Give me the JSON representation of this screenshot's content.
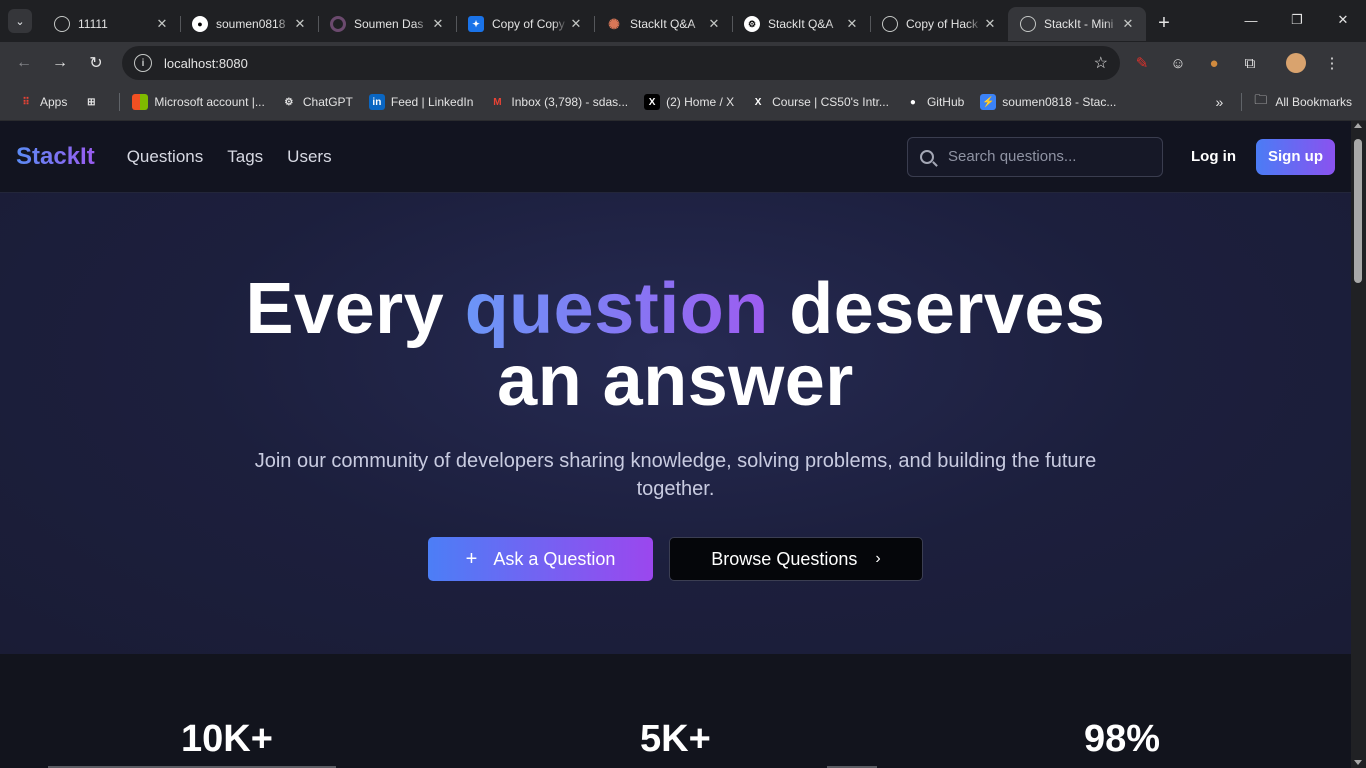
{
  "browser": {
    "tabs": [
      {
        "title": "11111",
        "favicon": "globe-icon",
        "active": false
      },
      {
        "title": "soumen0818",
        "favicon": "github-icon",
        "active": false
      },
      {
        "title": "Soumen Das",
        "favicon": "circle-icon",
        "active": false
      },
      {
        "title": "Copy of Copy",
        "favicon": "butterfly-icon",
        "active": false
      },
      {
        "title": "StackIt Q&A",
        "favicon": "claude-icon",
        "active": false
      },
      {
        "title": "StackIt Q&A",
        "favicon": "openai-icon",
        "active": false
      },
      {
        "title": "Copy of Hack",
        "favicon": "globe-icon",
        "active": false
      },
      {
        "title": "StackIt - Mini",
        "favicon": "globe-icon",
        "active": true
      }
    ],
    "url": "localhost:8080",
    "bookmarks": [
      {
        "label": "Apps",
        "icon": "apps-grid-icon"
      },
      {
        "label": "",
        "icon": "grid-icon"
      },
      {
        "label": "Microsoft account |...",
        "icon": "microsoft-icon"
      },
      {
        "label": "ChatGPT",
        "icon": "openai-icon"
      },
      {
        "label": "Feed | LinkedIn",
        "icon": "linkedin-icon"
      },
      {
        "label": "Inbox (3,798) - sdas...",
        "icon": "gmail-icon"
      },
      {
        "label": "(2) Home / X",
        "icon": "x-icon"
      },
      {
        "label": "Course | CS50's Intr...",
        "icon": "x-icon"
      },
      {
        "label": "GitHub",
        "icon": "github-icon"
      },
      {
        "label": "soumen0818 - Stac...",
        "icon": "bolt-icon"
      }
    ],
    "all_bookmarks": "All Bookmarks",
    "accent": "#35363a"
  },
  "site": {
    "logo": "StackIt",
    "nav": [
      "Questions",
      "Tags",
      "Users"
    ],
    "search_placeholder": "Search questions...",
    "login": "Log in",
    "signup": "Sign up"
  },
  "hero": {
    "title_pre": "Every ",
    "title_highlight": "question",
    "title_post": " deserves",
    "title_line2": "an answer",
    "subtitle": "Join our community of developers sharing knowledge, solving problems, and building the future together.",
    "ask_button": "Ask a Question",
    "browse_button": "Browse Questions"
  },
  "stats": [
    "10K+",
    "5K+",
    "98%"
  ],
  "colors": {
    "brand_gradient_start": "#4c7ef6",
    "brand_gradient_end": "#9b47ee",
    "hero_bg": "#1c1f3d"
  }
}
